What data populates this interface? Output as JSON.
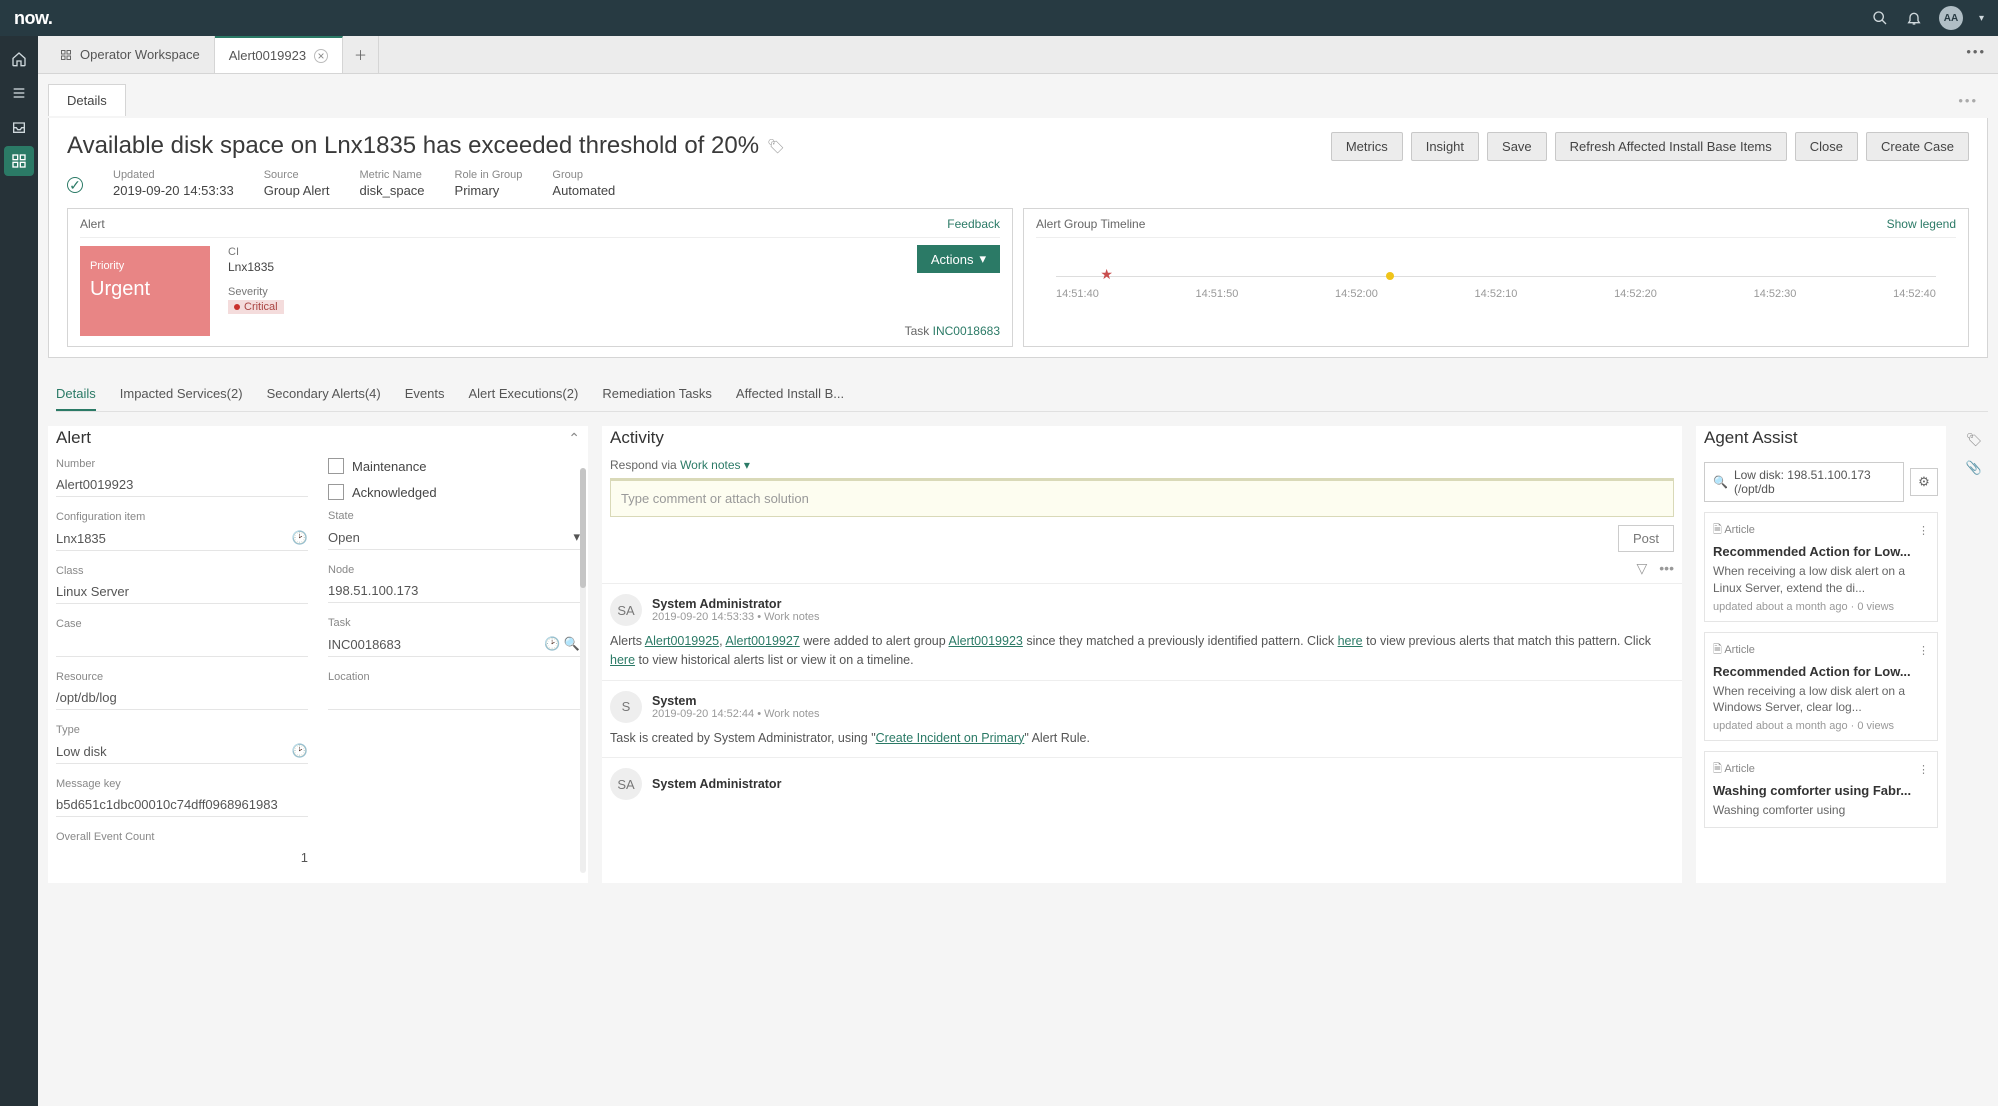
{
  "brand": "now.",
  "avatar_initials": "AA",
  "ws_tabs": [
    {
      "label": "Operator Workspace"
    },
    {
      "label": "Alert0019923"
    }
  ],
  "detail_tab": "Details",
  "header": {
    "title": "Available disk space on Lnx1835 has exceeded threshold of 20%",
    "buttons": [
      "Metrics",
      "Insight",
      "Save",
      "Refresh Affected Install Base Items",
      "Close",
      "Create Case"
    ],
    "meta": [
      {
        "label": "Updated",
        "value": "2019-09-20 14:53:33"
      },
      {
        "label": "Source",
        "value": "Group Alert"
      },
      {
        "label": "Metric Name",
        "value": "disk_space"
      },
      {
        "label": "Role in Group",
        "value": "Primary"
      },
      {
        "label": "Group",
        "value": "Automated"
      }
    ]
  },
  "alert_panel": {
    "title": "Alert",
    "feedback": "Feedback",
    "priority_label": "Priority",
    "priority_value": "Urgent",
    "ci_label": "CI",
    "ci_value": "Lnx1835",
    "sev_label": "Severity",
    "sev_value": "Critical",
    "actions": "Actions",
    "task_label": "Task",
    "task_link": "INC0018683"
  },
  "timeline_panel": {
    "title": "Alert Group Timeline",
    "legend": "Show legend",
    "ticks": [
      "14:51:40",
      "14:51:50",
      "14:52:00",
      "14:52:10",
      "14:52:20",
      "14:52:30",
      "14:52:40"
    ]
  },
  "section_tabs": [
    "Details",
    "Impacted Services(2)",
    "Secondary Alerts(4)",
    "Events",
    "Alert Executions(2)",
    "Remediation Tasks",
    "Affected Install B..."
  ],
  "alert_form": {
    "title": "Alert",
    "left": [
      {
        "label": "Number",
        "value": "Alert0019923"
      },
      {
        "label": "Configuration item",
        "value": "Lnx1835",
        "clock": true
      },
      {
        "label": "Class",
        "value": "Linux Server"
      },
      {
        "label": "Case",
        "value": ""
      },
      {
        "label": "Resource",
        "value": "/opt/db/log"
      },
      {
        "label": "Type",
        "value": "Low disk",
        "clock": true
      },
      {
        "label": "Message key",
        "value": "b5d651c1dbc00010c74dff0968961983"
      },
      {
        "label": "Overall Event Count",
        "value": "1"
      }
    ],
    "maintenance": "Maintenance",
    "acknowledged": "Acknowledged",
    "state_label": "State",
    "state_value": "Open",
    "node_label": "Node",
    "node_value": "198.51.100.173",
    "task_label": "Task",
    "task_value": "INC0018683",
    "location_label": "Location"
  },
  "activity": {
    "title": "Activity",
    "respond_prefix": "Respond via",
    "respond_link": "Work notes",
    "placeholder": "Type comment or attach solution",
    "post": "Post",
    "items": [
      {
        "avatar": "SA",
        "name": "System Administrator",
        "meta": "2019-09-20 14:53:33 • Work notes",
        "body_html": "Alerts <a>Alert0019925</a>, <a>Alert0019927</a> were added to alert group <a>Alert0019923</a> since they matched a previously identified pattern. Click <a>here</a> to view previous alerts that match this pattern. Click <a>here</a> to view historical alerts list or view it on a timeline."
      },
      {
        "avatar": "S",
        "name": "System",
        "meta": "2019-09-20 14:52:44 • Work notes",
        "body_html": "Task is created by System Administrator, using \"<a>Create Incident on Primary</a>\" Alert Rule."
      },
      {
        "avatar": "SA",
        "name": "System Administrator",
        "meta": "",
        "body_html": ""
      }
    ]
  },
  "assist": {
    "title": "Agent Assist",
    "search": "Low disk: 198.51.100.173 (/opt/db",
    "articles": [
      {
        "type": "Article",
        "title": "Recommended Action for Low...",
        "desc": "When receiving a low disk alert on a Linux Server, extend the di...",
        "foot": "updated about a month ago · 0 views"
      },
      {
        "type": "Article",
        "title": "Recommended Action for Low...",
        "desc": "When receiving a low disk alert on a Windows Server, clear log...",
        "foot": "updated about a month ago · 0 views"
      },
      {
        "type": "Article",
        "title": "Washing comforter using Fabr...",
        "desc": "Washing comforter using",
        "foot": ""
      }
    ]
  }
}
